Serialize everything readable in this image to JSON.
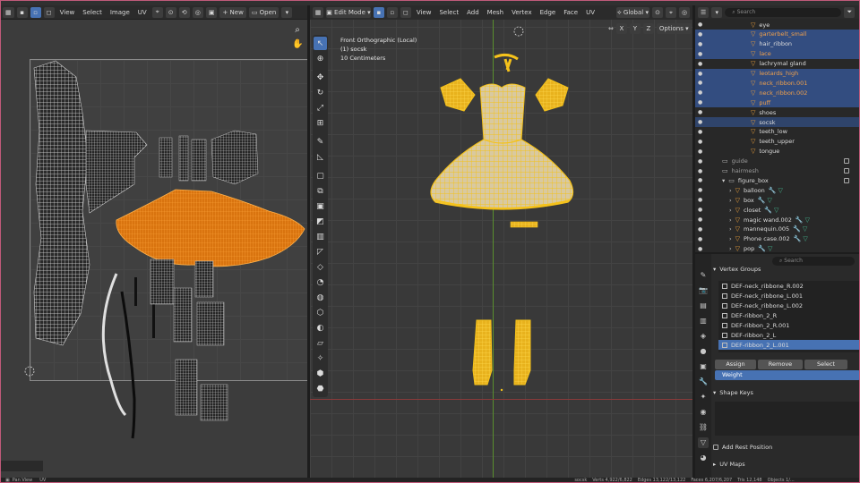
{
  "colors": {
    "accent": "#4772b3",
    "selection_orange": "#f08a1a",
    "mesh_yellow": "#f5c21b",
    "object_orange": "#f0a04b"
  },
  "uv_editor": {
    "header": {
      "menus": [
        "View",
        "Select",
        "Image",
        "UV"
      ],
      "new_label": "New",
      "open_label": "Open"
    },
    "footer": {
      "view_label": "Pan View",
      "uv_label": "UV"
    }
  },
  "viewport": {
    "header": {
      "mode": "Edit Mode",
      "menus": [
        "View",
        "Select",
        "Add",
        "Mesh",
        "Vertex",
        "Edge",
        "Face",
        "UV"
      ],
      "orientation": "Global",
      "options_label": "Options",
      "axes": [
        "X",
        "Y",
        "Z"
      ]
    },
    "info": {
      "view": "Front Orthographic (Local)",
      "object": "(1) socsk",
      "scale": "10 Centimeters"
    }
  },
  "outliner": {
    "search_placeholder": "Search",
    "rows": [
      {
        "label": "eye",
        "style": "white",
        "state": "none"
      },
      {
        "label": "garterbelt_small",
        "style": "orange",
        "state": "sel"
      },
      {
        "label": "hair_ribbon",
        "style": "white",
        "state": "sel"
      },
      {
        "label": "lace",
        "style": "orange",
        "state": "sel"
      },
      {
        "label": "lachrymal gland",
        "style": "white",
        "state": "none"
      },
      {
        "label": "leotards_high",
        "style": "orange",
        "state": "sel"
      },
      {
        "label": "neck_ribbon.001",
        "style": "orange",
        "state": "sel"
      },
      {
        "label": "neck_ribbon.002",
        "style": "orange",
        "state": "sel"
      },
      {
        "label": "puff",
        "style": "orange",
        "state": "sel"
      },
      {
        "label": "shoes",
        "style": "white",
        "state": "none"
      },
      {
        "label": "socsk",
        "style": "white",
        "state": "hl"
      },
      {
        "label": "teeth_low",
        "style": "white",
        "state": "none"
      },
      {
        "label": "teeth_upper",
        "style": "white",
        "state": "none"
      },
      {
        "label": "tongue",
        "style": "white",
        "state": "none"
      },
      {
        "label": "guide",
        "style": "grey",
        "state": "none"
      },
      {
        "label": "hairmesh",
        "style": "grey",
        "state": "none"
      },
      {
        "label": "figure_box",
        "style": "white",
        "state": "none"
      },
      {
        "label": "balloon",
        "style": "white",
        "state": "none"
      },
      {
        "label": "box",
        "style": "white",
        "state": "none"
      },
      {
        "label": "closet",
        "style": "white",
        "state": "none"
      },
      {
        "label": "magic wand.002",
        "style": "white",
        "state": "none"
      },
      {
        "label": "mannequin.005",
        "style": "white",
        "state": "none"
      },
      {
        "label": "Phone case.002",
        "style": "white",
        "state": "none"
      },
      {
        "label": "pop",
        "style": "white",
        "state": "none"
      }
    ]
  },
  "properties": {
    "search_placeholder": "Search",
    "vertex_groups_title": "Vertex Groups",
    "vertex_groups": [
      {
        "label": "DEF-neck_ribbone_R.002",
        "selected": false
      },
      {
        "label": "DEF-neck_ribbone_L.001",
        "selected": false
      },
      {
        "label": "DEF-neck_ribbone_L.002",
        "selected": false
      },
      {
        "label": "DEF-ribbon_2_R",
        "selected": false
      },
      {
        "label": "DEF-ribbon_2_R.001",
        "selected": false
      },
      {
        "label": "DEF-ribbon_2_L",
        "selected": false
      },
      {
        "label": "DEF-ribbon_2_L.001",
        "selected": true
      }
    ],
    "assign_label": "Assign",
    "remove_label": "Remove",
    "select_label": "Select",
    "weight_label": "Weight",
    "shape_keys_title": "Shape Keys",
    "add_rest_position_label": "Add Rest Position",
    "uv_maps_title": "UV Maps"
  },
  "status": {
    "object": "socsk",
    "verts": "Verts 4,922/6,822",
    "edges": "Edges 13,122/13,122",
    "faces": "Faces 6,207/6,207",
    "tris": "Tris 12,148",
    "objects": "Objects 1/..."
  }
}
